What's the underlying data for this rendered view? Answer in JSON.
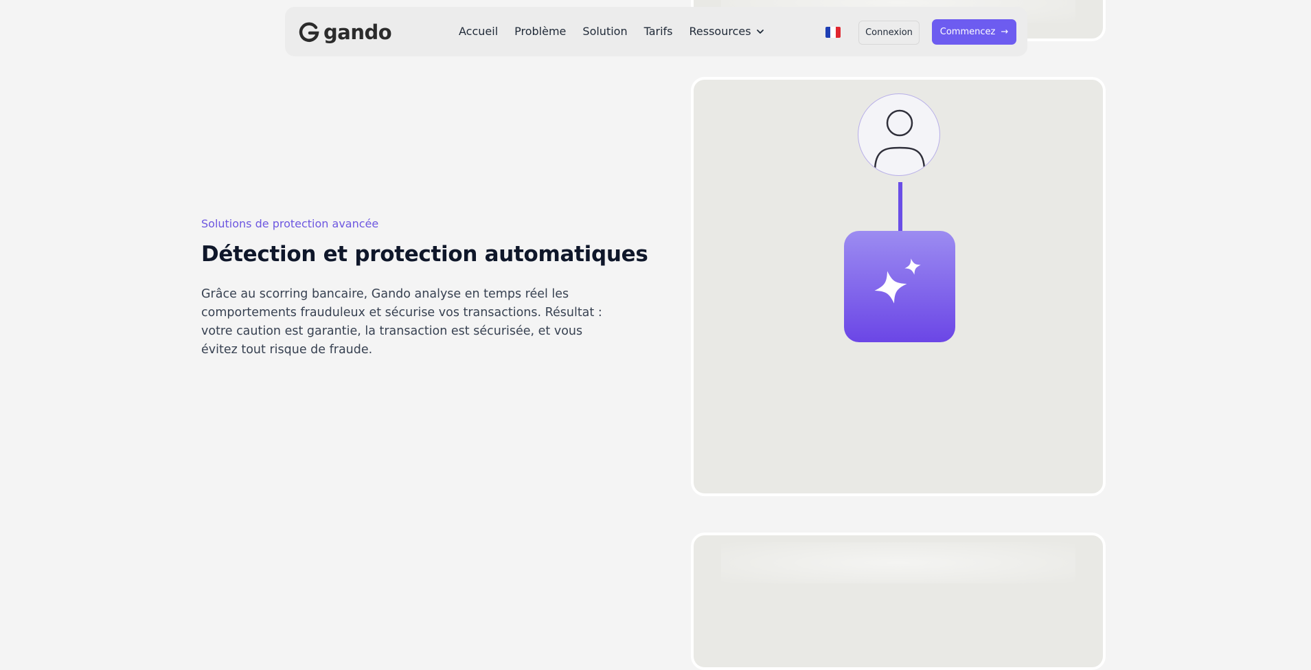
{
  "brand": {
    "name": "gando",
    "accent": "#6d5cf0"
  },
  "nav": {
    "links": [
      {
        "label": "Accueil"
      },
      {
        "label": "Problème"
      },
      {
        "label": "Solution"
      },
      {
        "label": "Tarifs"
      },
      {
        "label": "Ressources"
      }
    ],
    "language_flag": "fr-flag-icon",
    "login_label": "Connexion",
    "start_label": "Commencez",
    "start_arrow": "→"
  },
  "section": {
    "eyebrow": "Solutions de protection avancée",
    "title": "Détection et protection automatiques",
    "description": "Grâce au scorring bancaire, Gando analyse en temps réel les comportements frauduleux et sécurise vos transactions. Résultat : votre caution est garantie, la transaction est sécurisée, et vous évitez tout risque de fraude."
  },
  "illustration": {
    "icons": [
      "user-icon",
      "sparkles-icon"
    ]
  }
}
